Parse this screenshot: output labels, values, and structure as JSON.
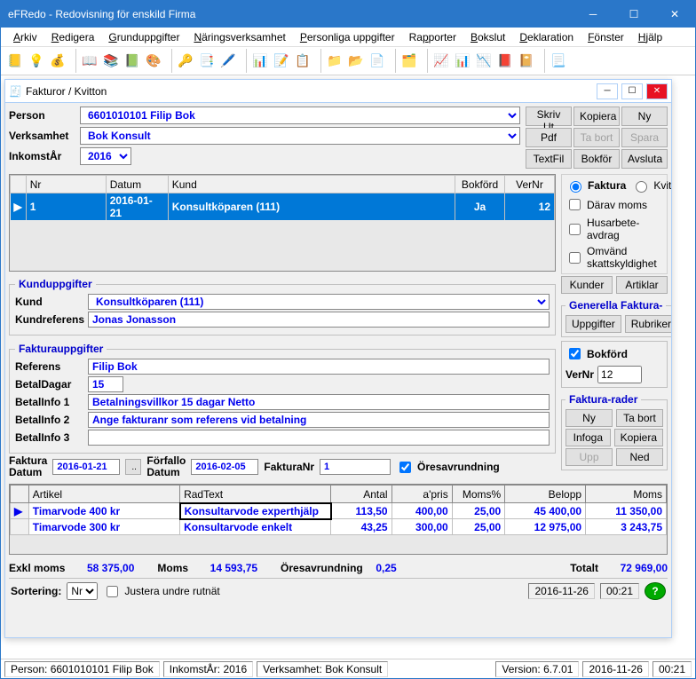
{
  "app": {
    "title": "eFRedo - Redovisning för enskild Firma"
  },
  "menubar": [
    {
      "label": "Arkiv",
      "u": 0
    },
    {
      "label": "Redigera",
      "u": 0
    },
    {
      "label": "Grunduppgifter",
      "u": 0
    },
    {
      "label": "Näringsverksamhet",
      "u": 0
    },
    {
      "label": "Personliga uppgifter",
      "u": 0
    },
    {
      "label": "Rapporter",
      "u": 2
    },
    {
      "label": "Bokslut",
      "u": 0
    },
    {
      "label": "Deklaration",
      "u": 0
    },
    {
      "label": "Fönster",
      "u": 0
    },
    {
      "label": "Hjälp",
      "u": 0
    }
  ],
  "mdi": {
    "title": "Fakturor / Kvitton",
    "person_label": "Person",
    "person_value": "6601010101     Filip Bok",
    "verksamhet_label": "Verksamhet",
    "verksamhet_value": "Bok Konsult",
    "inkomstar_label": "InkomstÅr",
    "inkomstar_value": "2016",
    "buttons": {
      "r1": [
        "Skriv Ut",
        "Kopiera",
        "Ny"
      ],
      "r2": [
        "Pdf",
        "Ta bort",
        "Spara"
      ],
      "r3": [
        "TextFil",
        "Bokför",
        "Avsluta"
      ]
    },
    "opts": {
      "faktura": "Faktura",
      "kvitto": "Kvitto",
      "daravmoms": "Därav moms",
      "husarbete": "Husarbete-avdrag",
      "omvand": "Omvänd skattskyldighet"
    },
    "grid1": {
      "cols": [
        "Nr",
        "Datum",
        "Kund",
        "Bokförd",
        "VerNr"
      ],
      "row": {
        "nr": "1",
        "datum": "2016-01-21",
        "kund": "Konsultköparen (111)",
        "bokford": "Ja",
        "vernr": "12"
      }
    },
    "kund": {
      "legend": "Kunduppgifter",
      "kund_label": "Kund",
      "kund_value": "Konsultköparen (111)",
      "kundref_label": "Kundreferens",
      "kundref_value": "Jonas Jonasson",
      "btn_kunder": "Kunder",
      "btn_artiklar": "Artiklar",
      "gen_legend": "Generella Faktura-",
      "btn_uppg": "Uppgifter",
      "btn_rubr": "Rubriker"
    },
    "faktura": {
      "legend": "Fakturauppgifter",
      "referens_label": "Referens",
      "referens_value": "Filip Bok",
      "betaldagar_label": "BetalDagar",
      "betaldagar_value": "15",
      "betalinfo1_label": "BetalInfo 1",
      "betalinfo1_value": "Betalningsvillkor 15 dagar Netto",
      "betalinfo2_label": "BetalInfo 2",
      "betalinfo2_value": "Ange fakturanr som referens vid betalning",
      "betalinfo3_label": "BetalInfo 3",
      "betalinfo3_value": "",
      "bokford_chk": "Bokförd",
      "vernr_label": "VerNr",
      "vernr_value": "12",
      "rader_legend": "Faktura-rader",
      "btn_ny": "Ny",
      "btn_tabort": "Ta bort",
      "btn_infoga": "Infoga",
      "btn_kopiera": "Kopiera",
      "btn_upp": "Upp",
      "btn_ned": "Ned"
    },
    "dates": {
      "fakturadatum_label1": "Faktura",
      "fakturadatum_label2": "Datum",
      "fakturadatum_value": "2016-01-21",
      "forfallodatum_label1": "Förfallo",
      "forfallodatum_label2": "Datum",
      "forfallodatum_value": "2016-02-05",
      "fakturanr_label": "FakturaNr",
      "fakturanr_value": "1",
      "oresavrundning": "Öresavrundning"
    },
    "grid2": {
      "cols": [
        "Artikel",
        "RadText",
        "Antal",
        "a'pris",
        "Moms%",
        "Belopp",
        "Moms"
      ],
      "rows": [
        {
          "artikel": "Timarvode 400 kr",
          "radtext": "Konsultarvode experthjälp",
          "antal": "113,50",
          "apris": "400,00",
          "momspct": "25,00",
          "belopp": "45 400,00",
          "moms": "11 350,00"
        },
        {
          "artikel": "Timarvode 300 kr",
          "radtext": "Konsultarvode enkelt",
          "antal": "43,25",
          "apris": "300,00",
          "momspct": "25,00",
          "belopp": "12 975,00",
          "moms": "3 243,75"
        }
      ]
    },
    "totals": {
      "exkl_label": "Exkl moms",
      "exkl_value": "58 375,00",
      "moms_label": "Moms",
      "moms_value": "14 593,75",
      "ores_label": "Öresavrundning",
      "ores_value": "0,25",
      "totalt_label": "Totalt",
      "totalt_value": "72 969,00"
    },
    "bottom": {
      "sort_label": "Sortering:",
      "sort_value": "Nr",
      "justera": "Justera undre rutnät",
      "date": "2016-11-26",
      "time": "00:21"
    }
  },
  "status": {
    "person": "Person: 6601010101  Filip Bok",
    "inkomstar": "InkomstÅr: 2016",
    "verksamhet": "Verksamhet: Bok Konsult",
    "version": "Version: 6.7.01",
    "date": "2016-11-26",
    "time": "00:21"
  }
}
